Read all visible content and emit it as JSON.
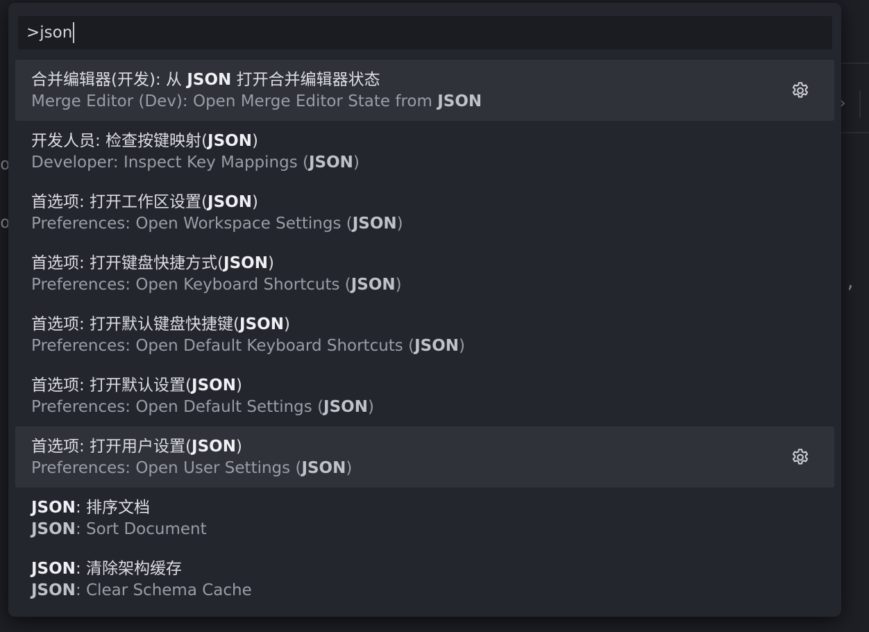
{
  "command_palette": {
    "input_value": ">json",
    "items": [
      {
        "title_pre": "合并编辑器(开发): 从 ",
        "title_hl": "JSON",
        "title_post": " 打开合并编辑器状态",
        "sub_pre": "Merge Editor (Dev): Open Merge Editor State from ",
        "sub_hl": "JSON",
        "sub_post": "",
        "active": true,
        "gear_icon": "gear-icon"
      },
      {
        "title_pre": "开发人员: 检查按键映射(",
        "title_hl": "JSON",
        "title_post": ")",
        "sub_pre": "Developer: Inspect Key Mappings (",
        "sub_hl": "JSON",
        "sub_post": ")"
      },
      {
        "title_pre": "首选项: 打开工作区设置(",
        "title_hl": "JSON",
        "title_post": ")",
        "sub_pre": "Preferences: Open Workspace Settings (",
        "sub_hl": "JSON",
        "sub_post": ")"
      },
      {
        "title_pre": "首选项: 打开键盘快捷方式(",
        "title_hl": "JSON",
        "title_post": ")",
        "sub_pre": "Preferences: Open Keyboard Shortcuts (",
        "sub_hl": "JSON",
        "sub_post": ")"
      },
      {
        "title_pre": "首选项: 打开默认键盘快捷键(",
        "title_hl": "JSON",
        "title_post": ")",
        "sub_pre": "Preferences: Open Default Keyboard Shortcuts (",
        "sub_hl": "JSON",
        "sub_post": ")"
      },
      {
        "title_pre": "首选项: 打开默认设置(",
        "title_hl": "JSON",
        "title_post": ")",
        "sub_pre": "Preferences: Open Default Settings (",
        "sub_hl": "JSON",
        "sub_post": ")"
      },
      {
        "title_pre": "首选项: 打开用户设置(",
        "title_hl": "JSON",
        "title_post": ")",
        "sub_pre": "Preferences: Open User Settings (",
        "sub_hl": "JSON",
        "sub_post": ")",
        "active": true,
        "gear_icon": "gear-icon"
      },
      {
        "title_pre": "",
        "title_hl": "JSON",
        "title_post": ": 排序文档",
        "sub_pre": "",
        "sub_hl": "JSON",
        "sub_post": ": Sort Document"
      },
      {
        "title_pre": "",
        "title_hl": "JSON",
        "title_post": ": 清除架构缓存",
        "sub_pre": "",
        "sub_hl": "JSON",
        "sub_post": ": Clear Schema Cache"
      }
    ]
  },
  "background": {
    "glyph_comma": ",",
    "glyph_o": "o",
    "glyph_chevron": "›"
  },
  "colors": {
    "palette_bg": "#24262e",
    "active_row_bg": "#30323a",
    "input_bg": "#1b1c22"
  }
}
